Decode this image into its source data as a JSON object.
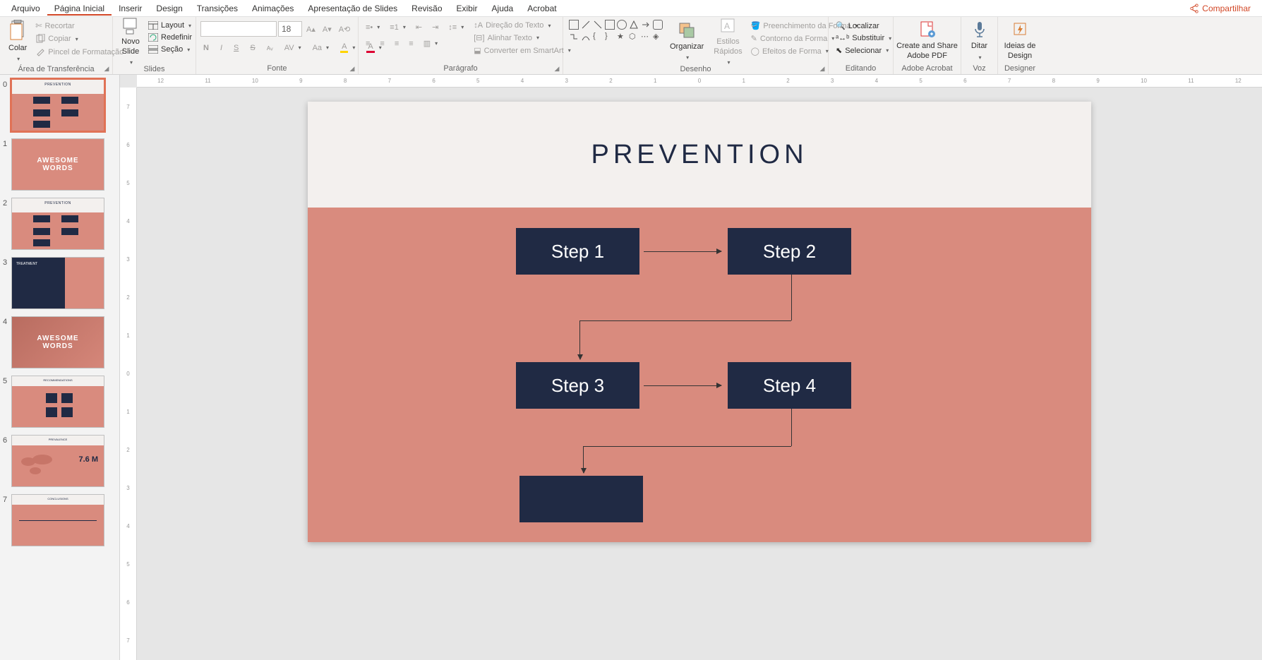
{
  "menu": {
    "items": [
      "Arquivo",
      "Página Inicial",
      "Inserir",
      "Design",
      "Transições",
      "Animações",
      "Apresentação de Slides",
      "Revisão",
      "Exibir",
      "Ajuda",
      "Acrobat"
    ],
    "share": "Compartilhar"
  },
  "ribbon": {
    "clipboard": {
      "paste": "Colar",
      "cut": "Recortar",
      "copy": "Copiar",
      "format_painter": "Pincel de Formatação",
      "label": "Área de Transferência"
    },
    "slides": {
      "new_slide": "Novo\nSlide",
      "layout": "Layout",
      "reset": "Redefinir",
      "section": "Seção",
      "label": "Slides"
    },
    "font": {
      "name": "",
      "size": "18",
      "bold": "N",
      "italic": "I",
      "underline": "S",
      "strike": "S",
      "label": "Fonte"
    },
    "paragraph": {
      "text_dir": "Direção do Texto",
      "align_text": "Alinhar Texto",
      "convert": "Converter em SmartArt",
      "label": "Parágrafo"
    },
    "drawing": {
      "arrange": "Organizar",
      "quick_styles": "Estilos\nRápidos",
      "fill": "Preenchimento da Forma",
      "outline": "Contorno da Forma",
      "effects": "Efeitos de Forma",
      "label": "Desenho"
    },
    "editing": {
      "find": "Localizar",
      "replace": "Substituir",
      "select": "Selecionar",
      "label": "Editando"
    },
    "acrobat": {
      "create_share": "Create and Share\nAdobe PDF",
      "label": "Adobe Acrobat"
    },
    "voice": {
      "dictate": "Ditar",
      "label": "Voz"
    },
    "designer": {
      "ideas": "Ideias de\nDesign",
      "label": "Designer"
    }
  },
  "thumbnails": [
    {
      "num": "0",
      "title": "PREVENTION",
      "type": "prevention",
      "selected": true
    },
    {
      "num": "1",
      "title": "AWESOME\nWORDS",
      "type": "awesome"
    },
    {
      "num": "2",
      "title": "PREVENTION",
      "type": "prevention"
    },
    {
      "num": "3",
      "title": "TREATMENT",
      "type": "treatment"
    },
    {
      "num": "4",
      "title": "AWESOME\nWORDS",
      "type": "awesome2"
    },
    {
      "num": "5",
      "title": "RECOMMENDATIONS",
      "type": "recs"
    },
    {
      "num": "6",
      "title": "PREVALENCE",
      "type": "prevalence",
      "extra": "7.6 M"
    },
    {
      "num": "7",
      "title": "CONCLUSIONS",
      "type": "conclusions"
    }
  ],
  "slide": {
    "title": "PREVENTION",
    "boxes": [
      "Step 1",
      "Step 2",
      "Step 3",
      "Step 4",
      ""
    ]
  },
  "ruler_h": [
    "12",
    "11",
    "10",
    "9",
    "8",
    "7",
    "6",
    "5",
    "4",
    "3",
    "2",
    "1",
    "0",
    "1",
    "2",
    "3",
    "4",
    "5",
    "6",
    "7",
    "8",
    "9",
    "10",
    "11",
    "12"
  ],
  "ruler_v": [
    "7",
    "6",
    "5",
    "4",
    "3",
    "2",
    "1",
    "0",
    "1",
    "2",
    "3",
    "4",
    "5",
    "6",
    "7"
  ]
}
